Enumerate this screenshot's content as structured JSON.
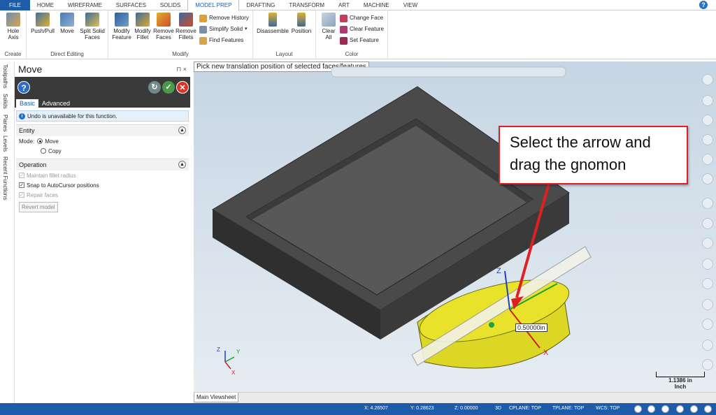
{
  "tabs": [
    "FILE",
    "HOME",
    "WIREFRAME",
    "SURFACES",
    "SOLIDS",
    "MODEL PREP",
    "DRAFTING",
    "TRANSFORM",
    "ART",
    "MACHINE",
    "VIEW"
  ],
  "active_tab": "MODEL PREP",
  "ribbon": {
    "create": {
      "label": "Create",
      "hole_axis": "Hole Axis"
    },
    "direct_editing": {
      "label": "Direct Editing",
      "push_pull": "Push/Pull",
      "move": "Move",
      "split_solid_faces": "Split Solid Faces"
    },
    "modify": {
      "label": "Modify",
      "modify_feature": "Modify Feature",
      "modify_fillet": "Modify Fillet",
      "remove_faces": "Remove Faces",
      "remove_fillets": "Remove Fillets",
      "remove_history": "Remove History",
      "simplify_solid": "Simplify Solid",
      "find_features": "Find Features"
    },
    "layout": {
      "label": "Layout",
      "disassemble": "Disassemble",
      "position": "Position"
    },
    "color": {
      "label": "Color",
      "clear_all": "Clear All",
      "change_face": "Change Face",
      "clear_feature": "Clear Feature",
      "set_feature": "Set Feature"
    }
  },
  "side_tabs": [
    "Toolpaths",
    "Solids",
    "Planes",
    "Levels",
    "Recent Functions"
  ],
  "panel": {
    "title": "Move",
    "pin": "⊓ ×",
    "subtabs": [
      "Basic",
      "Advanced"
    ],
    "info": "Undo is unavailable for this function.",
    "entity": {
      "header": "Entity",
      "mode_label": "Mode:",
      "move": "Move",
      "copy": "Copy"
    },
    "operation": {
      "header": "Operation",
      "maintain_fillet": "Maintain fillet radius",
      "snap": "Snap to AutoCursor positions",
      "repair": "Repair faces",
      "revert": "Revert model"
    }
  },
  "viewport": {
    "prompt": "Pick new translation position of selected faces/features",
    "callout": "Select the arrow and drag the gnomon",
    "dimension": "0.50000in",
    "scale_value": "1.1386 in",
    "scale_unit": "Inch",
    "axes": {
      "x": "X",
      "y": "Y",
      "z": "Z"
    }
  },
  "viewsheet_tab": "Main Viewsheet",
  "status": {
    "x": "X:  4.26507",
    "y": "Y:  0.28623",
    "z": "Z:  0.00000",
    "mode": "3D",
    "cplane": "CPLANE: TOP",
    "tplane": "TPLANE: TOP",
    "wcs": "WCS: TOP"
  },
  "colors": {
    "accent": "#1e5ba8",
    "part": "#3f3f3f",
    "cylinder": "#e8e32a",
    "callout_border": "#e02020"
  }
}
